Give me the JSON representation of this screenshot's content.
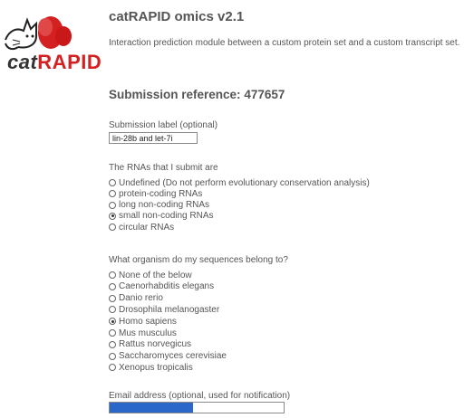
{
  "app": {
    "logo_text_a": "cat",
    "logo_text_b": "RAPID",
    "title": "catRAPID omics v2.1",
    "subtitle": "Interaction prediction module between a custom protein set and a custom transcript set."
  },
  "submission": {
    "reference_label": "Submission reference:",
    "reference_value": "477657",
    "label_caption": "Submission label (optional)",
    "label_value": "lin-28b and let-7i"
  },
  "rna_group": {
    "question": "The RNAs that I submit are",
    "options": [
      {
        "label": "Undefined (Do not perform evolutionary conservation analysis)",
        "checked": false
      },
      {
        "label": "protein-coding RNAs",
        "checked": false
      },
      {
        "label": "long non-coding RNAs",
        "checked": false
      },
      {
        "label": "small non-coding RNAs",
        "checked": true
      },
      {
        "label": "circular RNAs",
        "checked": false
      }
    ]
  },
  "organism_group": {
    "question": "What organism do my sequences belong to?",
    "options": [
      {
        "label": "None of the below",
        "checked": false
      },
      {
        "label": "Caenorhabditis elegans",
        "checked": false
      },
      {
        "label": "Danio rerio",
        "checked": false
      },
      {
        "label": "Drosophila melanogaster",
        "checked": false
      },
      {
        "label": "Homo sapiens",
        "checked": true
      },
      {
        "label": "Mus musculus",
        "checked": false
      },
      {
        "label": "Rattus norvegicus",
        "checked": false
      },
      {
        "label": "Saccharomyces cerevisiae",
        "checked": false
      },
      {
        "label": "Xenopus tropicalis",
        "checked": false
      }
    ]
  },
  "email": {
    "caption": "Email address (optional, used for notification)",
    "value": "",
    "selection_fill": 0.48,
    "selection_color": "#2a67c9"
  },
  "colors": {
    "logo_red": "#d42020"
  },
  "icons": {
    "logo": "cat-with-red-blob-logo"
  }
}
